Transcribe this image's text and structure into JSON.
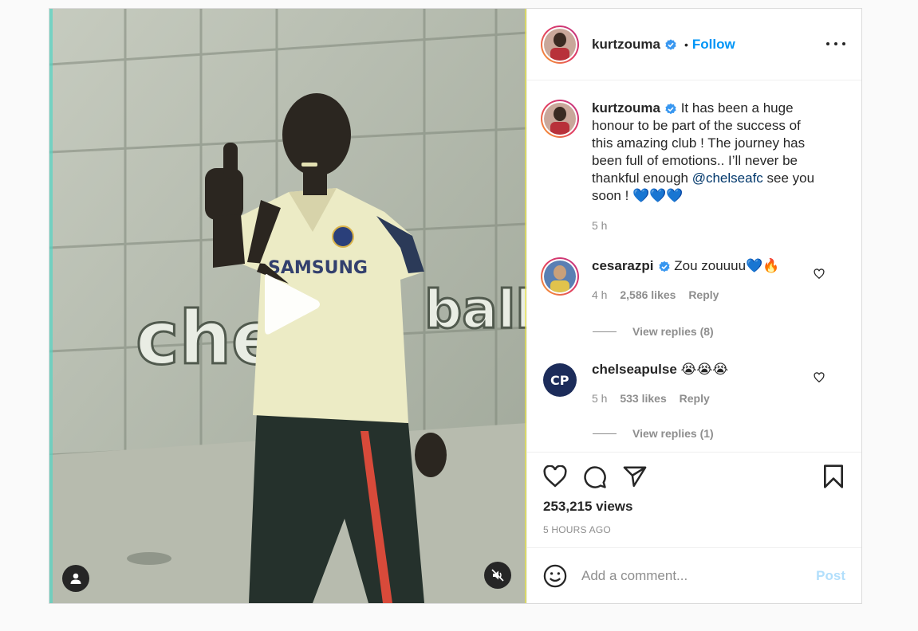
{
  "post": {
    "author": {
      "username": "kurtzouma",
      "follow_label": "Follow",
      "separator": "•"
    },
    "caption": {
      "username": "kurtzouma",
      "text_before_mention": "It has been a huge honour to be part of the success of this amazing club ! The journey has been full of emotions.. I’ll never be thankful enough ",
      "mention": "@chelseafc",
      "text_after_mention": " see you soon ! 💙💙💙",
      "time": "5 h"
    },
    "comments": [
      {
        "username": "cesarazpi",
        "text": "Zou zouuuu💙🔥",
        "time": "4 h",
        "likes": "2,586 likes",
        "reply_label": "Reply",
        "view_replies": "View replies (8)"
      },
      {
        "username": "chelseapulse",
        "text": "😭😭😭",
        "time": "5 h",
        "likes": "533 likes",
        "reply_label": "Reply",
        "view_replies": "View replies (1)"
      }
    ],
    "stats": {
      "views": "253,215 views",
      "time_ago": "5 HOURS AGO"
    },
    "add_comment": {
      "placeholder": "Add a comment...",
      "post_label": "Post"
    },
    "video_sign": {
      "left": "chels",
      "right": "ball cl"
    },
    "shirt_text": "SAMSUNG",
    "colors": {
      "accent": "#0095f6",
      "mention": "#00376b",
      "muted": "#8e8e8e",
      "verified": "#3897f0",
      "post_disabled": "#b2dffc"
    },
    "icons": {
      "verified": "verified-badge-icon",
      "more": "more-options-icon",
      "like": "heart-icon",
      "comment": "comment-icon",
      "share": "share-icon",
      "save": "bookmark-icon",
      "emoji": "emoji-icon",
      "play": "play-icon",
      "user": "user-tag-icon",
      "mute": "muted-speaker-icon"
    }
  }
}
